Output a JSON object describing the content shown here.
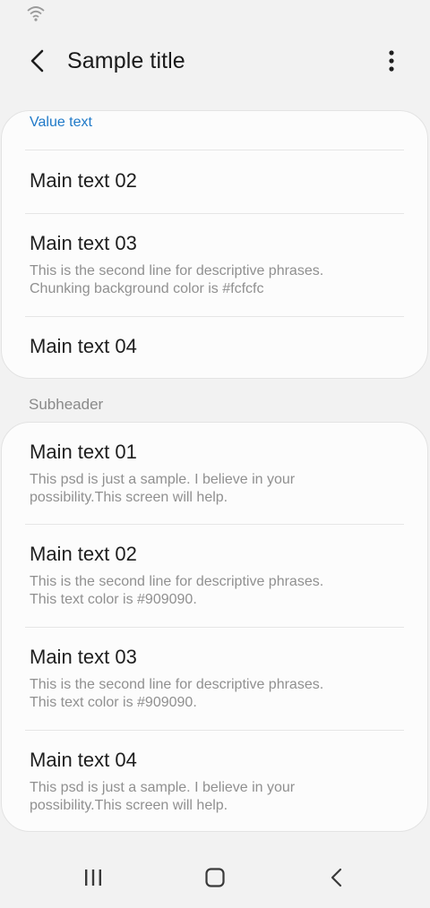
{
  "app_bar": {
    "title": "Sample title",
    "back_icon": "back-arrow-icon",
    "more_icon": "more-vertical-icon"
  },
  "status_bar": {
    "icons": [
      "wifi-icon"
    ]
  },
  "colors": {
    "accent": "#1f79c8",
    "card_background": "#fcfcfc",
    "secondary_text": "#909090",
    "page_background": "#f2f2f2"
  },
  "card1": {
    "value_text": "Value text",
    "items": [
      {
        "main": "Main text 02"
      },
      {
        "main": "Main text 03",
        "sub1": "This is the second line for descriptive phrases.",
        "sub2": "Chunking background color is #fcfcfc"
      },
      {
        "main": "Main text 04"
      }
    ]
  },
  "subheader": "Subheader",
  "card2": {
    "items": [
      {
        "main": "Main text 01",
        "sub1": "This psd is just a sample. I believe in your",
        "sub2": "possibility.This screen will help."
      },
      {
        "main": "Main text 02",
        "sub1": "This is the second line for descriptive phrases.",
        "sub2": "This text color is #909090."
      },
      {
        "main": "Main text 03",
        "sub1": "This is the second line for descriptive phrases.",
        "sub2": "This text color is #909090."
      },
      {
        "main": "Main text 04",
        "sub1": "This psd is just a sample. I believe in your",
        "sub2": "possibility.This screen will help."
      }
    ]
  },
  "nav_bar": {
    "icons": [
      "recent-apps-icon",
      "home-icon",
      "back-icon"
    ]
  }
}
